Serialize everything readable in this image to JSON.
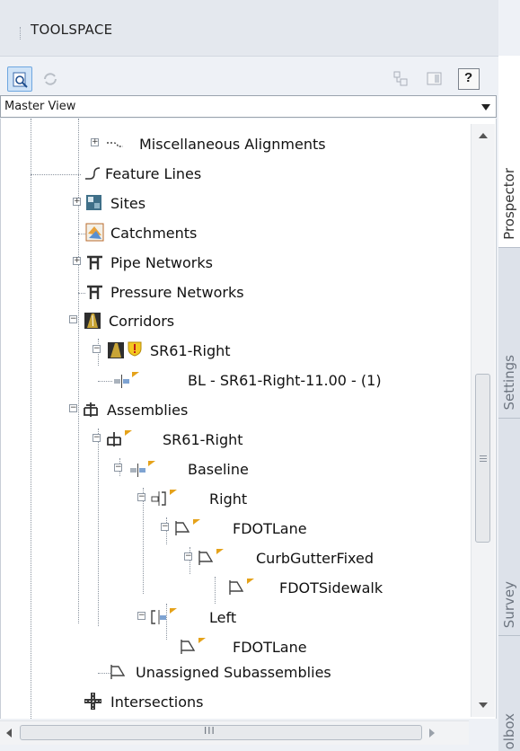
{
  "palette": {
    "title": "TOOLSPACE"
  },
  "view_selector": {
    "selected": "Master View"
  },
  "tabs": [
    "Prospector",
    "Settings",
    "Survey",
    "olbox"
  ],
  "tree": [
    {
      "label": "Miscellaneous Alignments",
      "icon": "misc-alignments-icon",
      "expander": "+"
    },
    {
      "label": "Feature Lines",
      "icon": "feature-line-icon",
      "expander": ""
    },
    {
      "label": "Sites",
      "icon": "sites-icon",
      "expander": "+"
    },
    {
      "label": "Catchments",
      "icon": "catchments-icon",
      "expander": ""
    },
    {
      "label": "Pipe Networks",
      "icon": "pipe-network-icon",
      "expander": "+"
    },
    {
      "label": "Pressure Networks",
      "icon": "pressure-network-icon",
      "expander": ""
    },
    {
      "label": "Corridors",
      "icon": "corridor-icon",
      "expander": "-"
    },
    {
      "label": "SR61-Right",
      "icon": "corridor-warning-icon",
      "expander": "-"
    },
    {
      "label": "BL - SR61-Right-11.00 - (1)",
      "icon": "baseline-icon",
      "expander": ""
    },
    {
      "label": "Assemblies",
      "icon": "assembly-icon",
      "expander": "-"
    },
    {
      "label": "SR61-Right",
      "icon": "assembly-icon",
      "expander": "-"
    },
    {
      "label": "Baseline",
      "icon": "baseline-icon",
      "expander": "-"
    },
    {
      "label": "Right",
      "icon": "group-right-icon",
      "expander": "-"
    },
    {
      "label": "FDOTLane",
      "icon": "subassembly-icon",
      "expander": "-"
    },
    {
      "label": "CurbGutterFixed",
      "icon": "subassembly-icon",
      "expander": "-"
    },
    {
      "label": "FDOTSidewalk",
      "icon": "subassembly-icon",
      "expander": ""
    },
    {
      "label": "Left",
      "icon": "group-left-icon",
      "expander": "-"
    },
    {
      "label": "FDOTLane",
      "icon": "subassembly-icon",
      "expander": ""
    },
    {
      "label": "Unassigned Subassemblies",
      "icon": "subassembly-icon",
      "expander": ""
    },
    {
      "label": "Intersections",
      "icon": "intersection-icon",
      "expander": ""
    }
  ],
  "scroll_grip": "III"
}
